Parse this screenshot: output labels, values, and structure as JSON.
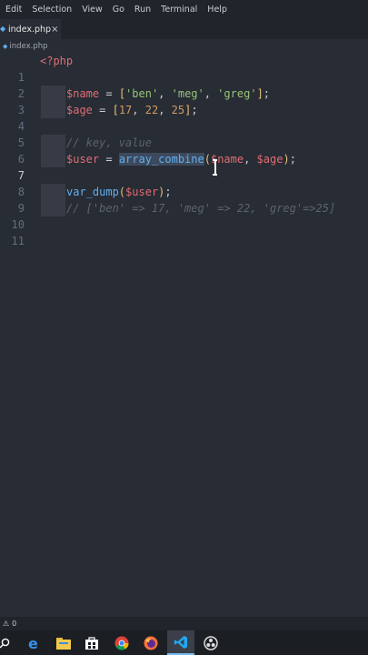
{
  "menu": [
    "Edit",
    "Selection",
    "View",
    "Go",
    "Run",
    "Terminal",
    "Help"
  ],
  "tab": {
    "label": "index.php",
    "close": "×"
  },
  "breadcrumb": "index.php",
  "line_numbers": [
    "1",
    "2",
    "3",
    "4",
    "5",
    "6",
    "7",
    "8",
    "9",
    "10",
    "11"
  ],
  "code": {
    "l1_tag": "<?php",
    "l3_var": "$name",
    "l3_eq": " = ",
    "l3_ob": "[",
    "l3_s1": "'ben'",
    "l3_c1": ", ",
    "l3_s2": "'meg'",
    "l3_c2": ", ",
    "l3_s3": "'greg'",
    "l3_cb": "]",
    "l3_end": ";",
    "l4_var": "$age",
    "l4_eq": " = ",
    "l4_ob": "[",
    "l4_n1": "17",
    "l4_c1": ", ",
    "l4_n2": "22",
    "l4_c2": ", ",
    "l4_n3": "25",
    "l4_cb": "]",
    "l4_end": ";",
    "l6_com": "// key, value",
    "l7_var": "$user",
    "l7_eq": " = ",
    "l7_fn": "array_combine",
    "l7_op": "(",
    "l7_a1": "$name",
    "l7_c": ", ",
    "l7_a2": "$age",
    "l7_cp": ")",
    "l7_end": ";",
    "l9_fn": "var_dump",
    "l9_op": "(",
    "l9_a": "$user",
    "l9_cp": ")",
    "l9_end": ";",
    "l10_com": "// ['ben' => 17, 'meg' => 22, 'greg'=>25]"
  },
  "status": {
    "warnings": "0"
  },
  "colors": {
    "accent": "#61afef",
    "editor_bg": "#282c34"
  },
  "taskbar_icons": [
    "search-icon",
    "edge-icon",
    "file-explorer-icon",
    "store-icon",
    "chrome-icon",
    "firefox-icon",
    "vscode-icon",
    "obs-icon"
  ]
}
